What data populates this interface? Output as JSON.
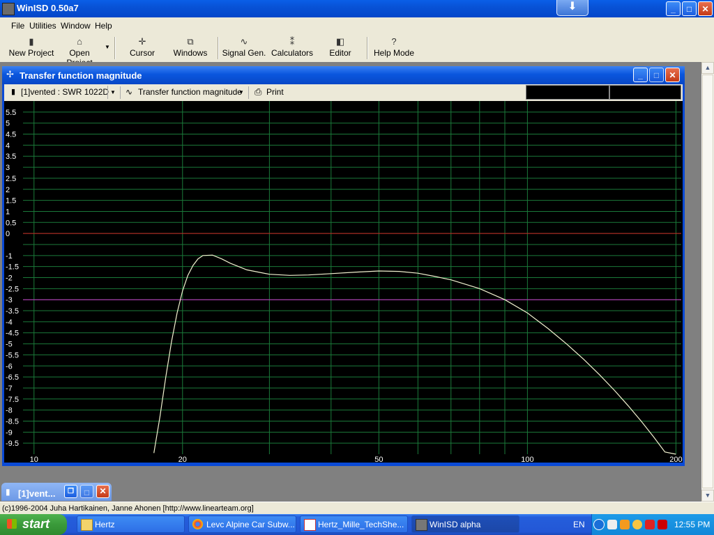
{
  "app": {
    "title": "WinISD 0.50a7",
    "min": "_",
    "max": "□",
    "close": "✕"
  },
  "menu": [
    {
      "label": "File"
    },
    {
      "label": "Utilities"
    },
    {
      "label": "Window"
    },
    {
      "label": "Help"
    }
  ],
  "toolbar": [
    {
      "label": "New Project",
      "icon": "▮"
    },
    {
      "label": "Open Project",
      "icon": "⌂"
    },
    {
      "label": "Cursor",
      "icon": "✛"
    },
    {
      "label": "Windows",
      "icon": "⧉"
    },
    {
      "label": "Signal Gen.",
      "icon": "∿"
    },
    {
      "label": "Calculators",
      "icon": "⁑"
    },
    {
      "label": "Editor",
      "icon": "◧"
    },
    {
      "label": "Help Mode",
      "icon": "?"
    }
  ],
  "child": {
    "title": "Transfer function magnitude",
    "project_select": "[1]vented : SWR 1022D",
    "graph_select": "Transfer function magnitude",
    "print_label": "Print"
  },
  "minimized_child": {
    "title": "[1]vent..."
  },
  "status": {
    "text": "(c)1996-2004 Juha Hartikainen, Janne Ahonen [http://www.linearteam.org]"
  },
  "taskbar": {
    "start": "start",
    "items": [
      {
        "label": "Hertz"
      },
      {
        "label": "Levc Alpine Car Subw..."
      },
      {
        "label": "Hertz_Mille_TechShe..."
      },
      {
        "label": "WinISD alpha"
      }
    ],
    "lang": "EN",
    "clock": "12:55 PM"
  },
  "chart_data": {
    "type": "line",
    "xlabel": "",
    "ylabel": "",
    "x_scale": "log",
    "xlim": [
      9.5,
      205
    ],
    "ylim": [
      -10,
      6
    ],
    "x_tick_labels": [
      "10",
      "20",
      "50",
      "100",
      "200"
    ],
    "y_tick_labels": [
      "5.5",
      "5",
      "4.5",
      "4",
      "3.5",
      "3",
      "2.5",
      "2",
      "1.5",
      "1",
      "0.5",
      "0",
      "-1",
      "-1.5",
      "-2",
      "-2.5",
      "-3",
      "-3.5",
      "-4",
      "-4.5",
      "-5",
      "-5.5",
      "-6",
      "-6.5",
      "-7",
      "-7.5",
      "-8",
      "-8.5",
      "-9",
      "-9.5"
    ],
    "grid": true,
    "reference_lines": [
      {
        "y": 0,
        "color": "#cc2222"
      },
      {
        "y": -3,
        "color": "#cc33cc"
      }
    ],
    "colors": {
      "background": "#000000",
      "grid": "#1b7a3a",
      "curve": "#f2f2d0"
    },
    "series": [
      {
        "x": [
          17.5,
          18,
          18.5,
          19,
          19.5,
          20,
          20.5,
          21,
          21.5,
          22,
          23,
          24,
          25,
          27,
          30,
          33,
          36,
          40,
          45,
          50,
          55,
          60,
          65,
          70,
          80,
          90,
          100,
          110,
          120,
          130,
          140,
          150,
          160,
          170,
          180,
          190,
          200
        ],
        "y": [
          -9.95,
          -8.3,
          -6.5,
          -4.9,
          -3.6,
          -2.6,
          -1.9,
          -1.45,
          -1.15,
          -1.0,
          -0.98,
          -1.15,
          -1.35,
          -1.65,
          -1.85,
          -1.9,
          -1.88,
          -1.82,
          -1.75,
          -1.7,
          -1.72,
          -1.8,
          -1.95,
          -2.1,
          -2.5,
          -3.0,
          -3.6,
          -4.3,
          -5.0,
          -5.7,
          -6.4,
          -7.1,
          -7.8,
          -8.5,
          -9.2,
          -9.9,
          -10.0
        ]
      }
    ]
  }
}
